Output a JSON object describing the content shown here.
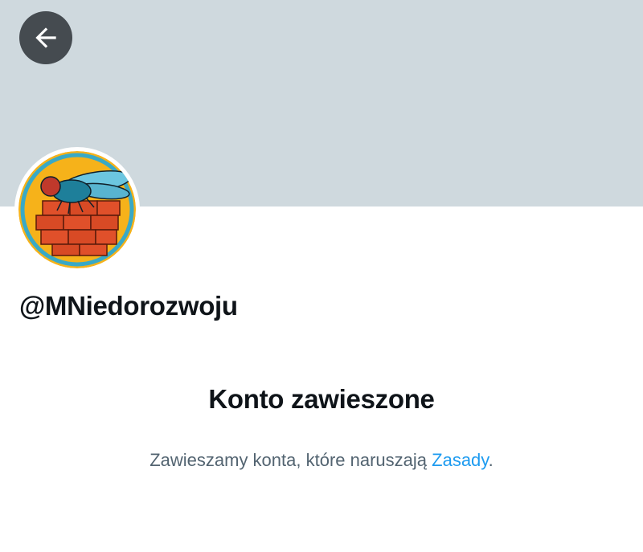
{
  "header": {
    "back_icon": "arrow-left-icon",
    "banner_color": "#cfd9de"
  },
  "profile": {
    "handle": "@MNiedorozwoju",
    "avatar_icon": "fly-on-bricks-avatar"
  },
  "suspension": {
    "title": "Konto zawieszone",
    "message_prefix": "Zawieszamy konta, które naruszają ",
    "rules_link": "Zasady",
    "message_suffix": "."
  },
  "colors": {
    "text_primary": "#0f1419",
    "text_secondary": "#536471",
    "link": "#1d9bf0"
  }
}
